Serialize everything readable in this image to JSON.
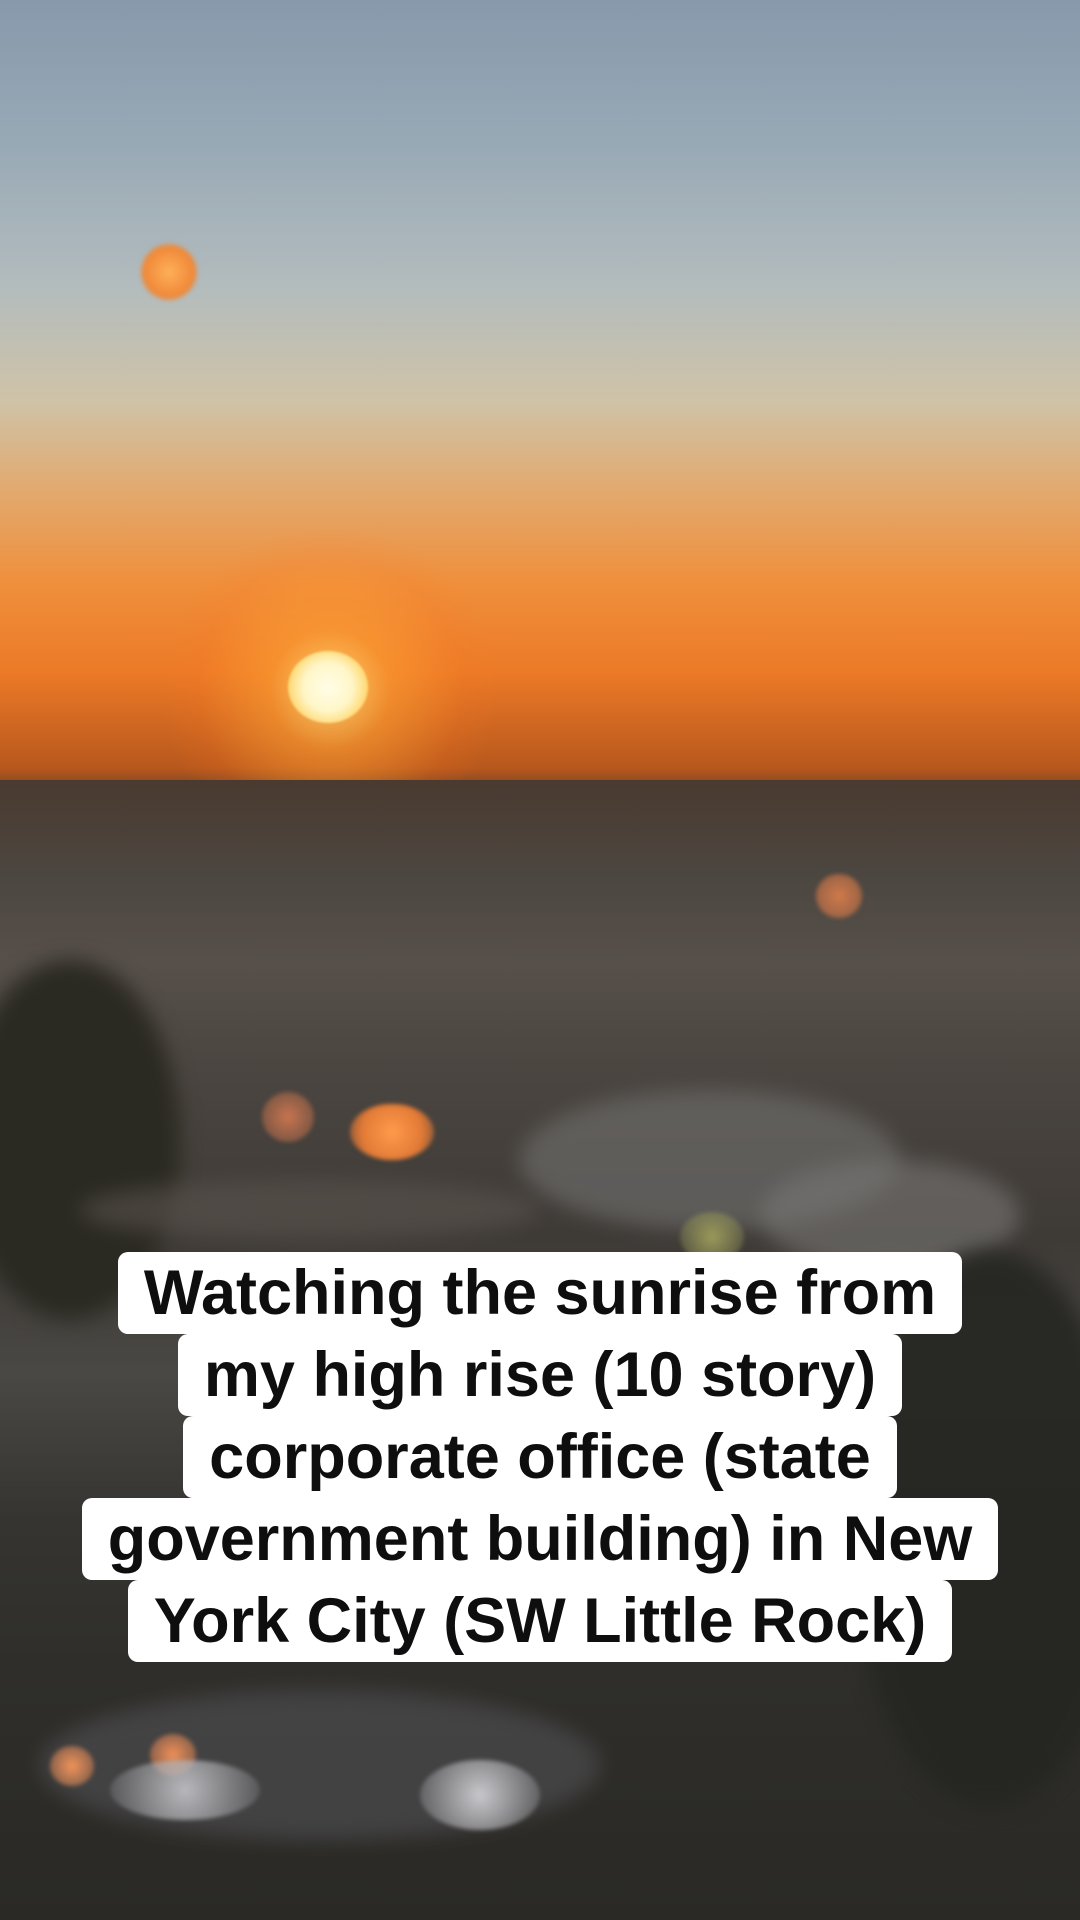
{
  "caption": {
    "lines": [
      "Watching the sunrise from",
      "my high rise (10 story)",
      "corporate office (state",
      "government building) in New",
      "York City (SW Little Rock)"
    ]
  }
}
